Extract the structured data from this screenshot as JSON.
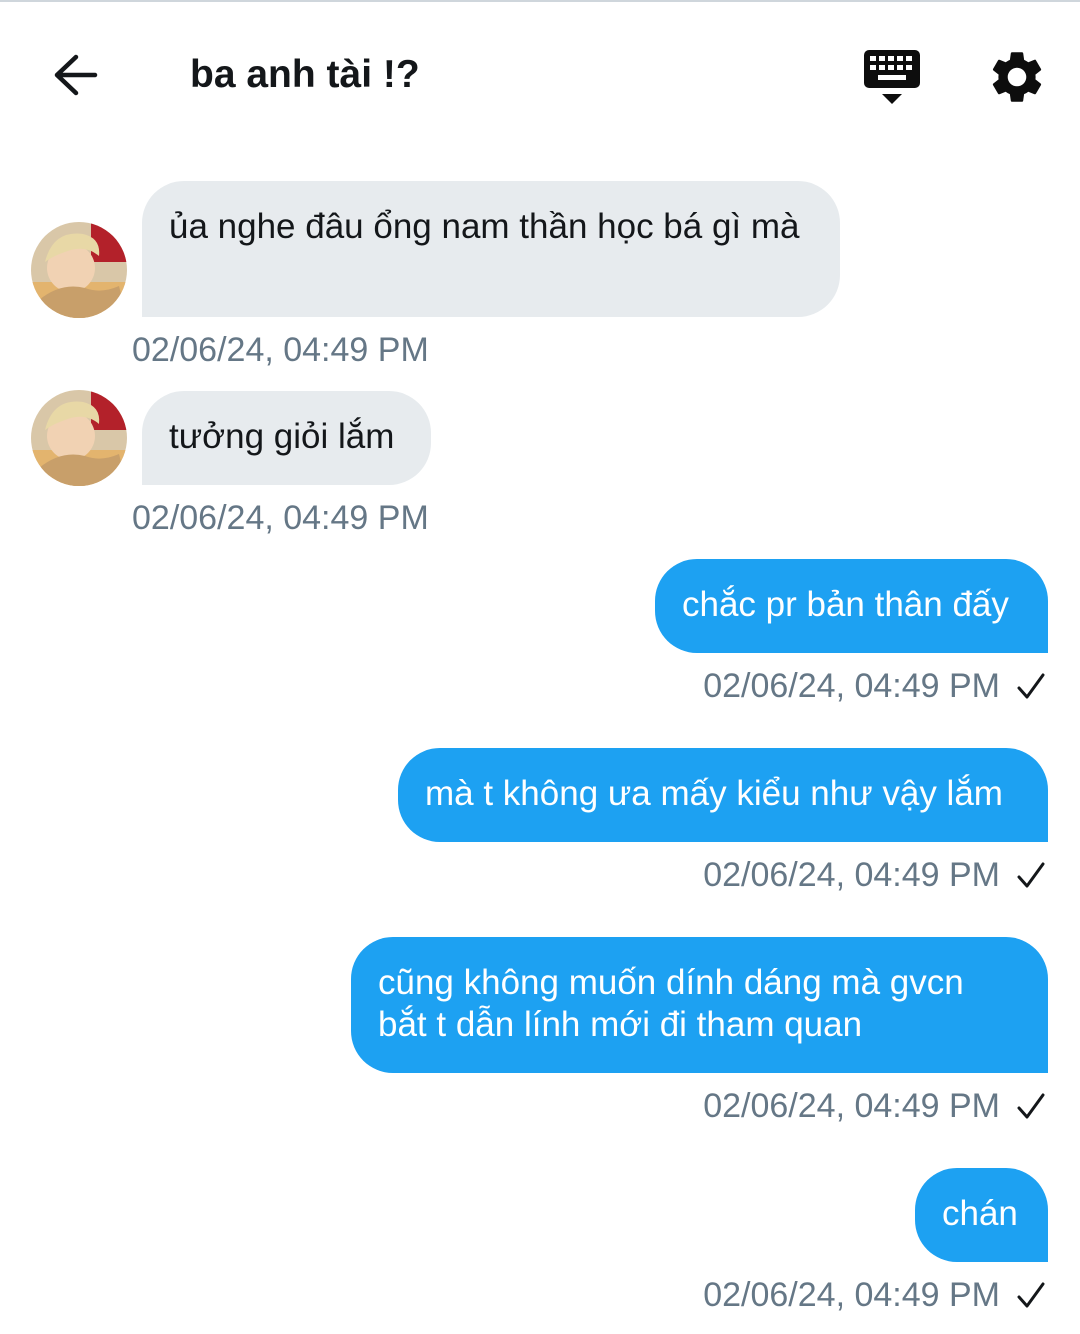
{
  "header": {
    "title": "ba anh tài !?",
    "back_icon": "arrow-left-icon",
    "keyboard_icon": "keyboard-hide-icon",
    "settings_icon": "gear-icon"
  },
  "colors": {
    "outgoing_bubble": "#1da1f2",
    "incoming_bubble": "#e7ebee",
    "timestamp": "#657786"
  },
  "messages": [
    {
      "direction": "incoming",
      "text": "ủa nghe đâu ổng nam thần học bá gì mà",
      "timestamp": "02/06/24, 04:49 PM"
    },
    {
      "direction": "incoming",
      "text": "tưởng giỏi lắm",
      "timestamp": "02/06/24, 04:49 PM"
    },
    {
      "direction": "outgoing",
      "text": "chắc pr bản thân đấy",
      "timestamp": "02/06/24, 04:49 PM",
      "status_icon": "check-icon"
    },
    {
      "direction": "outgoing",
      "text": "mà t không ưa mấy kiểu như vậy lắm",
      "timestamp": "02/06/24, 04:49 PM",
      "status_icon": "check-icon"
    },
    {
      "direction": "outgoing",
      "text": "cũng không muốn dính dáng mà gvcn bắt t dẫn lính mới đi tham quan",
      "timestamp": "02/06/24, 04:49 PM",
      "status_icon": "check-icon"
    },
    {
      "direction": "outgoing",
      "text": "chán",
      "timestamp": "02/06/24, 04:49 PM",
      "status_icon": "check-icon"
    }
  ]
}
